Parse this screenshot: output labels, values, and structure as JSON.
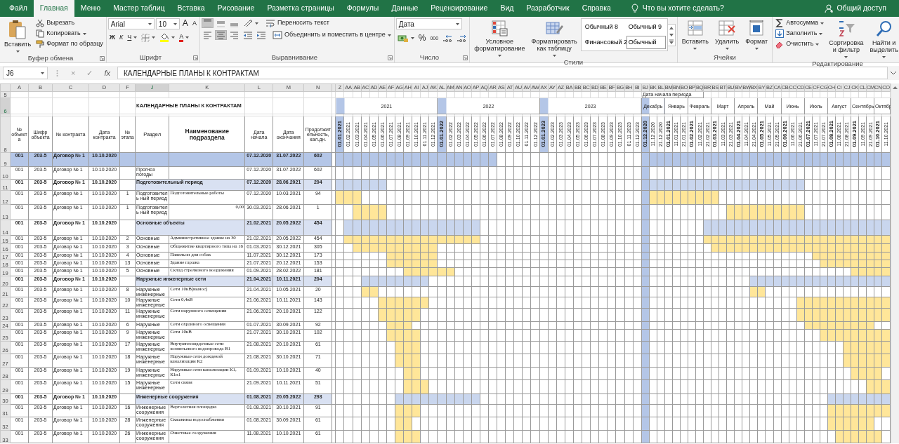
{
  "tabs": [
    {
      "label": "Файл",
      "selected": false
    },
    {
      "label": "Главная",
      "selected": true
    },
    {
      "label": "Меню",
      "selected": false
    },
    {
      "label": "Мастер таблиц",
      "selected": false
    },
    {
      "label": "Вставка",
      "selected": false
    },
    {
      "label": "Рисование",
      "selected": false
    },
    {
      "label": "Разметка страницы",
      "selected": false
    },
    {
      "label": "Формулы",
      "selected": false
    },
    {
      "label": "Данные",
      "selected": false
    },
    {
      "label": "Рецензирование",
      "selected": false
    },
    {
      "label": "Вид",
      "selected": false
    },
    {
      "label": "Разработчик",
      "selected": false
    },
    {
      "label": "Справка",
      "selected": false
    }
  ],
  "tell_me": "Что вы хотите сделать?",
  "share": "Общий доступ",
  "ribbon": [
    {
      "kind": "clipboard",
      "label": "Буфер обмена",
      "paste": "Вставить",
      "actions": [
        {
          "label": "Вырезать",
          "dropdown": false
        },
        {
          "label": "Копировать",
          "dropdown": true
        },
        {
          "label": "Формат по образцу",
          "dropdown": false
        }
      ]
    },
    {
      "kind": "font",
      "label": "Шрифт",
      "font": "Arial",
      "size": "10",
      "grow": "A",
      "shrink": "A",
      "bold": "Ж",
      "italic": "К",
      "underline": "Ч",
      "color_letter": "A"
    },
    {
      "kind": "alignment",
      "label": "Выравнивание",
      "vertical_align": [
        {
          "selected": true
        },
        {
          "selected": false
        },
        {
          "selected": false
        }
      ],
      "horizontal_align": [
        {
          "selected": false
        },
        {
          "selected": true
        },
        {
          "selected": false
        }
      ],
      "wrap": "Переносить текст",
      "merge": "Объединить и поместить в центре"
    },
    {
      "kind": "number",
      "label": "Число",
      "format": "Дата",
      "percent": "%",
      "thousands": "000"
    },
    {
      "kind": "styles",
      "label": "Стили",
      "buttons": [
        {
          "lines": [
            "Условное",
            "форматирование"
          ]
        },
        {
          "lines": [
            "Форматировать",
            "как таблицу"
          ]
        }
      ],
      "gallery": [
        {
          "label": "Обычный 8",
          "selected": false
        },
        {
          "label": "Обычный 9",
          "selected": false
        },
        {
          "label": "Финансовый 2",
          "selected": false
        },
        {
          "label": "Обычный",
          "selected": true
        }
      ]
    },
    {
      "kind": "cells",
      "label": "Ячейки",
      "buttons": [
        "Вставить",
        "Удалить",
        "Формат"
      ]
    },
    {
      "kind": "editing",
      "label": "Редактирование",
      "actions": [
        "Автосумма",
        "Заполнить",
        "Очистить"
      ],
      "buttons": [
        {
          "lines": [
            "Сортировка",
            "и фильтр"
          ]
        },
        {
          "lines": [
            "Найти и",
            "выделить"
          ]
        }
      ]
    }
  ],
  "formula_bar": {
    "name_box": "J6",
    "cancel": "×",
    "enter": "✓",
    "fx": "fx",
    "formula": "КАЛЕНДАРНЫЕ ПЛАНЫ К КОНТРАКТАМ"
  },
  "sheet": {
    "columns": [
      {
        "letter": "A",
        "heading": "№ объекта",
        "selected": false
      },
      {
        "letter": "B",
        "heading": "Шифр объекта",
        "selected": false
      },
      {
        "letter": "C",
        "heading": "№ контракта",
        "selected": false
      },
      {
        "letter": "D",
        "heading": "Дата контракта",
        "selected": false
      },
      {
        "letter": "F",
        "heading": "№ этапа",
        "selected": false
      },
      {
        "letter": "J",
        "heading": "Раздел",
        "selected": true
      },
      {
        "letter": "K",
        "heading": "Наименование подраздела",
        "selected": false
      },
      {
        "letter": "L",
        "heading": "Дата начала",
        "selected": false
      },
      {
        "letter": "M",
        "heading": "Дата окончания",
        "selected": false
      },
      {
        "letter": "N",
        "heading": "Продолжительность, кал.дн.",
        "selected": false
      }
    ],
    "header_rows": [
      {
        "number": "5",
        "selected": false
      },
      {
        "number": "6",
        "selected": true
      },
      {
        "number": "8",
        "selected": false
      }
    ],
    "title": "КАЛЕНДАРНЫЕ ПЛАНЫ К КОНТРАКТАМ",
    "period_caption": "Дата начала периода",
    "years": [
      {
        "label": "2021",
        "columns": [
          {
            "letter": "Z",
            "date": "01.01.2021",
            "bold": true,
            "highlighted": true,
            "current": false
          },
          {
            "letter": "AA",
            "date": "01.02.2021",
            "bold": false,
            "highlighted": false,
            "current": false
          },
          {
            "letter": "AB",
            "date": "01.03.2021",
            "bold": false,
            "highlighted": false,
            "current": false
          },
          {
            "letter": "AC",
            "date": "01.04.2021",
            "bold": false,
            "highlighted": false,
            "current": false
          },
          {
            "letter": "AD",
            "date": "01.05.2021",
            "bold": false,
            "highlighted": false,
            "current": false
          },
          {
            "letter": "AE",
            "date": "01.06.2021",
            "bold": false,
            "highlighted": false,
            "current": false
          },
          {
            "letter": "AF",
            "date": "01.07.2021",
            "bold": false,
            "highlighted": false,
            "current": false
          },
          {
            "letter": "AG",
            "date": "01.08.2021",
            "bold": false,
            "highlighted": false,
            "current": false
          },
          {
            "letter": "AH",
            "date": "01.09.2021",
            "bold": false,
            "highlighted": false,
            "current": false
          },
          {
            "letter": "AI",
            "date": "01.10.2021",
            "bold": false,
            "highlighted": false,
            "current": false
          },
          {
            "letter": "AJ",
            "date": "01.11.2021",
            "bold": false,
            "highlighted": false,
            "current": false
          },
          {
            "letter": "AK",
            "date": "01.12.2021",
            "bold": false,
            "highlighted": false,
            "current": false
          }
        ]
      },
      {
        "label": "2022",
        "columns": [
          {
            "letter": "AL",
            "date": "01.01.2022",
            "bold": true,
            "highlighted": true,
            "current": false
          },
          {
            "letter": "AM",
            "date": "01.02.2022",
            "bold": false,
            "highlighted": false,
            "current": false
          },
          {
            "letter": "AN",
            "date": "01.03.2022",
            "bold": false,
            "highlighted": false,
            "current": false
          },
          {
            "letter": "AO",
            "date": "01.04.2022",
            "bold": false,
            "highlighted": false,
            "current": false
          },
          {
            "letter": "AP",
            "date": "01.05.2022",
            "bold": false,
            "highlighted": false,
            "current": false
          },
          {
            "letter": "AQ",
            "date": "01.06.2022",
            "bold": false,
            "highlighted": false,
            "current": false
          },
          {
            "letter": "AR",
            "date": "01.07.2022",
            "bold": false,
            "highlighted": false,
            "current": false
          },
          {
            "letter": "AS",
            "date": "01.08.2022",
            "bold": false,
            "highlighted": false,
            "current": false
          },
          {
            "letter": "AT",
            "date": "01.09.2022",
            "bold": false,
            "highlighted": false,
            "current": false
          },
          {
            "letter": "AU",
            "date": "01.10.2022",
            "bold": false,
            "highlighted": false,
            "current": false
          },
          {
            "letter": "AV",
            "date": "01.11.2022",
            "bold": false,
            "highlighted": false,
            "current": false
          },
          {
            "letter": "AW",
            "date": "01.12.2022",
            "bold": false,
            "highlighted": false,
            "current": false
          }
        ]
      },
      {
        "label": "2023",
        "columns": [
          {
            "letter": "AX",
            "date": "01.01.2023",
            "bold": true,
            "highlighted": true,
            "current": false
          },
          {
            "letter": "AY",
            "date": "01.02.2023",
            "bold": false,
            "highlighted": false,
            "current": false
          },
          {
            "letter": "AZ",
            "date": "01.03.2023",
            "bold": false,
            "highlighted": false,
            "current": false
          },
          {
            "letter": "BA",
            "date": "01.04.2023",
            "bold": false,
            "highlighted": false,
            "current": false
          },
          {
            "letter": "BB",
            "date": "01.05.2023",
            "bold": false,
            "highlighted": false,
            "current": false
          },
          {
            "letter": "BC",
            "date": "01.06.2023",
            "bold": false,
            "highlighted": false,
            "current": false
          },
          {
            "letter": "BD",
            "date": "01.07.2023",
            "bold": false,
            "highlighted": false,
            "current": false
          },
          {
            "letter": "BE",
            "date": "01.08.2023",
            "bold": false,
            "highlighted": false,
            "current": false
          },
          {
            "letter": "BF",
            "date": "01.09.2023",
            "bold": false,
            "highlighted": false,
            "current": false
          },
          {
            "letter": "BG",
            "date": "01.10.2023",
            "bold": false,
            "highlighted": false,
            "current": false
          },
          {
            "letter": "BH",
            "date": "01.11.2023",
            "bold": false,
            "highlighted": false,
            "current": false
          },
          {
            "letter": "BI",
            "date": "01.12.2023",
            "bold": false,
            "highlighted": false,
            "current": false
          }
        ]
      }
    ],
    "months": [
      {
        "label": "Декабрь",
        "columns": [
          {
            "letter": "BJ",
            "date": "01.12.2020",
            "bold": true,
            "highlighted": true,
            "current": true
          },
          {
            "letter": "BK",
            "date": "11.12.2020",
            "bold": false,
            "highlighted": false,
            "current": false
          },
          {
            "letter": "BL",
            "date": "21.12.2020",
            "bold": false,
            "highlighted": false,
            "current": false
          }
        ]
      },
      {
        "label": "Январь",
        "columns": [
          {
            "letter": "BM",
            "date": "01.01.2021",
            "bold": true,
            "highlighted": false,
            "current": false
          },
          {
            "letter": "BN",
            "date": "11.01.2021",
            "bold": false,
            "highlighted": false,
            "current": false
          },
          {
            "letter": "BO",
            "date": "21.01.2021",
            "bold": false,
            "highlighted": false,
            "current": false
          }
        ]
      },
      {
        "label": "Февраль",
        "columns": [
          {
            "letter": "BP",
            "date": "01.02.2021",
            "bold": true,
            "highlighted": false,
            "current": false
          },
          {
            "letter": "BQ",
            "date": "11.02.2021",
            "bold": false,
            "highlighted": false,
            "current": false
          },
          {
            "letter": "BR",
            "date": "21.02.2021",
            "bold": false,
            "highlighted": false,
            "current": false
          }
        ]
      },
      {
        "label": "Март",
        "columns": [
          {
            "letter": "BS",
            "date": "01.03.2021",
            "bold": true,
            "highlighted": false,
            "current": false
          },
          {
            "letter": "BT",
            "date": "11.03.2021",
            "bold": false,
            "highlighted": false,
            "current": false
          },
          {
            "letter": "BU",
            "date": "21.03.2021",
            "bold": false,
            "highlighted": false,
            "current": false
          }
        ]
      },
      {
        "label": "Апрель",
        "columns": [
          {
            "letter": "BV",
            "date": "01.04.2021",
            "bold": true,
            "highlighted": false,
            "current": false
          },
          {
            "letter": "BW",
            "date": "11.04.2021",
            "bold": false,
            "highlighted": false,
            "current": false
          },
          {
            "letter": "BX",
            "date": "21.04.2021",
            "bold": false,
            "highlighted": false,
            "current": false
          }
        ]
      },
      {
        "label": "Май",
        "columns": [
          {
            "letter": "BY",
            "date": "01.05.2021",
            "bold": true,
            "highlighted": false,
            "current": false
          },
          {
            "letter": "BZ",
            "date": "11.05.2021",
            "bold": false,
            "highlighted": false,
            "current": false
          },
          {
            "letter": "CA",
            "date": "21.05.2021",
            "bold": false,
            "highlighted": false,
            "current": false
          }
        ]
      },
      {
        "label": "Июнь",
        "columns": [
          {
            "letter": "CB",
            "date": "01.06.2021",
            "bold": true,
            "highlighted": false,
            "current": false
          },
          {
            "letter": "CC",
            "date": "11.06.2021",
            "bold": false,
            "highlighted": false,
            "current": false
          },
          {
            "letter": "CD",
            "date": "21.06.2021",
            "bold": false,
            "highlighted": false,
            "current": false
          }
        ]
      },
      {
        "label": "Июль",
        "columns": [
          {
            "letter": "CE",
            "date": "01.07.2021",
            "bold": true,
            "highlighted": false,
            "current": false
          },
          {
            "letter": "CF",
            "date": "11.07.2021",
            "bold": false,
            "highlighted": false,
            "current": false
          },
          {
            "letter": "CG",
            "date": "21.07.2021",
            "bold": false,
            "highlighted": false,
            "current": false
          }
        ]
      },
      {
        "label": "Август",
        "columns": [
          {
            "letter": "CH",
            "date": "01.08.2021",
            "bold": true,
            "highlighted": false,
            "current": false
          },
          {
            "letter": "CI",
            "date": "11.08.2021",
            "bold": false,
            "highlighted": false,
            "current": false
          },
          {
            "letter": "CJ",
            "date": "21.08.2021",
            "bold": false,
            "highlighted": false,
            "current": false
          }
        ]
      },
      {
        "label": "Сентябрь",
        "columns": [
          {
            "letter": "CK",
            "date": "01.09.2021",
            "bold": true,
            "highlighted": false,
            "current": false
          },
          {
            "letter": "CL",
            "date": "11.09.2021",
            "bold": false,
            "highlighted": false,
            "current": false
          },
          {
            "letter": "CM",
            "date": "21.09.2021",
            "bold": false,
            "highlighted": false,
            "current": false
          }
        ]
      },
      {
        "label": "Октябр",
        "columns": [
          {
            "letter": "CN",
            "date": "01.10.2021",
            "bold": true,
            "highlighted": false,
            "current": false
          },
          {
            "letter": "CO",
            "date": "11.10.2021",
            "bold": false,
            "highlighted": false,
            "current": false
          }
        ]
      }
    ],
    "rows": [
      {
        "number": "9",
        "kind": "total",
        "selected": false,
        "object": "001",
        "code": "203-5",
        "contract": "Договор № 1",
        "contract_date": "10.10.2020",
        "start": "07.12.2020",
        "end": "31.07.2022",
        "duration": "602",
        "color": "#b4c6e7"
      },
      {
        "number": "10",
        "kind": "task",
        "selected": false,
        "object": "001",
        "code": "203-5",
        "contract": "Договор № 1",
        "contract_date": "10.10.2020",
        "section": "Прогноз погоды",
        "start": "07.12.2020",
        "end": "31.07.2022",
        "duration": "602"
      },
      {
        "number": "11",
        "kind": "section",
        "selected": false,
        "object": "001",
        "code": "203-5",
        "contract": "Договор № 1",
        "contract_date": "10.10.2020",
        "section": "Подготовительный период",
        "start": "07.12.2020",
        "end": "28.06.2021",
        "duration": "204",
        "color": "#c9d6ee"
      },
      {
        "number": "12",
        "kind": "task",
        "selected": false,
        "object": "001",
        "code": "203-5",
        "contract": "Договор № 1",
        "contract_date": "10.10.2020",
        "stage": "1",
        "section": "Подготовитель ный период",
        "subsection": "Подготовительные работы",
        "start": "07.12.2020",
        "end": "10.03.2021",
        "duration": "94",
        "color": "#ffe699"
      },
      {
        "number": "13",
        "kind": "amount",
        "selected": false,
        "object": "001",
        "code": "203-5",
        "contract": "Договор № 1",
        "contract_date": "10.10.2020",
        "stage": "1",
        "section": "Подготовитель ный период",
        "subsection": "0,00",
        "start": "30.03.2021",
        "end": "28.06.2021",
        "duration": "1",
        "color": "#ffe699"
      },
      {
        "number": "14",
        "kind": "section",
        "selected": false,
        "object": "001",
        "code": "203-5",
        "contract": "Договор № 1",
        "contract_date": "10.10.2020",
        "section": "Основные объекты",
        "start": "21.02.2021",
        "end": "20.05.2022",
        "duration": "454",
        "color": "#c9d6ee"
      },
      {
        "number": "15",
        "kind": "task",
        "selected": false,
        "object": "001",
        "code": "203-5",
        "contract": "Договор № 1",
        "contract_date": "10.10.2020",
        "stage": "2",
        "section": "Основные",
        "subsection": "Административное здание на 30",
        "start": "21.02.2021",
        "end": "20.05.2022",
        "duration": "454",
        "color": "#ffe699"
      },
      {
        "number": "16",
        "kind": "task",
        "selected": false,
        "object": "001",
        "code": "203-5",
        "contract": "Договор № 1",
        "contract_date": "10.10.2020",
        "stage": "3",
        "section": "Основные",
        "subsection": "Общежитие квартирного типа на 16",
        "start": "01.03.2021",
        "end": "30.12.2021",
        "duration": "305",
        "color": "#ffe699"
      },
      {
        "number": "17",
        "kind": "task",
        "selected": false,
        "object": "001",
        "code": "203-5",
        "contract": "Договор № 1",
        "contract_date": "10.10.2020",
        "stage": "4",
        "section": "Основные",
        "subsection": "Павильон для собак",
        "start": "11.07.2021",
        "end": "30.12.2021",
        "duration": "173",
        "color": "#ffe699"
      },
      {
        "number": "18",
        "kind": "task",
        "selected": false,
        "object": "001",
        "code": "203-5",
        "contract": "Договор № 1",
        "contract_date": "10.10.2020",
        "stage": "13",
        "section": "Основные",
        "subsection": "Здание гаража",
        "start": "21.07.2021",
        "end": "20.12.2021",
        "duration": "153",
        "color": "#ffe699"
      },
      {
        "number": "19",
        "kind": "task",
        "selected": false,
        "object": "001",
        "code": "203-5",
        "contract": "Договор № 1",
        "contract_date": "10.10.2020",
        "stage": "5",
        "section": "Основные",
        "subsection": "Склад стрелкового вооружения",
        "start": "01.09.2021",
        "end": "28.02.2022",
        "duration": "181",
        "color": "#ffe699"
      },
      {
        "number": "20",
        "kind": "section",
        "selected": false,
        "object": "001",
        "code": "203-5",
        "contract": "Договор № 1",
        "contract_date": "10.10.2020",
        "section": "Наружные инженерные сети",
        "start": "21.04.2021",
        "end": "10.11.2021",
        "duration": "204",
        "color": "#c9d6ee"
      },
      {
        "number": "21",
        "kind": "task",
        "selected": false,
        "object": "001",
        "code": "203-5",
        "contract": "Договор № 1",
        "contract_date": "10.10.2020",
        "stage": "8",
        "section": "Наружные инженерные",
        "subsection": "Сети 10кВ(вынос)",
        "start": "21.04.2021",
        "end": "10.05.2021",
        "duration": "20",
        "color": "#ffe699"
      },
      {
        "number": "22",
        "kind": "task",
        "selected": false,
        "object": "001",
        "code": "203-5",
        "contract": "Договор № 1",
        "contract_date": "10.10.2020",
        "stage": "10",
        "section": "Наружные инженерные",
        "subsection": "Сети 0,4кВ",
        "start": "21.06.2021",
        "end": "10.11.2021",
        "duration": "143",
        "color": "#ffe699"
      },
      {
        "number": "23",
        "kind": "task",
        "selected": false,
        "object": "001",
        "code": "203-5",
        "contract": "Договор № 1",
        "contract_date": "10.10.2020",
        "stage": "11",
        "section": "Наружные инженерные",
        "subsection": "Сети наружного освещения",
        "start": "21.06.2021",
        "end": "20.10.2021",
        "duration": "122",
        "color": "#ffe699"
      },
      {
        "number": "24",
        "kind": "task",
        "selected": false,
        "object": "001",
        "code": "203-5",
        "contract": "Договор № 1",
        "contract_date": "10.10.2020",
        "stage": "6",
        "section": "Наружные",
        "subsection": "Сети охранного освещения",
        "start": "01.07.2021",
        "end": "30.09.2021",
        "duration": "92",
        "color": "#ffe699"
      },
      {
        "number": "25",
        "kind": "task",
        "selected": false,
        "object": "001",
        "code": "203-5",
        "contract": "Договор № 1",
        "contract_date": "10.10.2020",
        "stage": "9",
        "section": "Наружные инженерные",
        "subsection": "Сети 10кВ",
        "start": "21.07.2021",
        "end": "30.10.2021",
        "duration": "102",
        "color": "#ffe699"
      },
      {
        "number": "26",
        "kind": "task",
        "selected": false,
        "object": "001",
        "code": "203-5",
        "contract": "Договор № 1",
        "contract_date": "10.10.2020",
        "stage": "17",
        "section": "Наружные инженерные",
        "subsection": "Внутриплощадочные сети хозпитьевого водопровода В1",
        "start": "21.08.2021",
        "end": "20.10.2021",
        "duration": "61",
        "color": "#ffe699"
      },
      {
        "number": "27",
        "kind": "task",
        "selected": false,
        "object": "001",
        "code": "203-5",
        "contract": "Договор № 1",
        "contract_date": "10.10.2020",
        "stage": "18",
        "section": "Наружные инженерные",
        "subsection": "Наружные сети дождевой канализации К2",
        "start": "21.08.2021",
        "end": "30.10.2021",
        "duration": "71",
        "color": "#ffe699"
      },
      {
        "number": "28",
        "kind": "task",
        "selected": false,
        "object": "001",
        "code": "203-5",
        "contract": "Договор № 1",
        "contract_date": "10.10.2020",
        "stage": "19",
        "section": "Наружные инженерные",
        "subsection": "Наружные сети канализации К1, К1н1",
        "start": "01.09.2021",
        "end": "10.10.2021",
        "duration": "40",
        "color": "#ffe699"
      },
      {
        "number": "29",
        "kind": "task",
        "selected": false,
        "object": "001",
        "code": "203-5",
        "contract": "Договор № 1",
        "contract_date": "10.10.2020",
        "stage": "15",
        "section": "Наружные инженерные",
        "subsection": "Сети связи",
        "start": "21.09.2021",
        "end": "10.11.2021",
        "duration": "51",
        "color": "#ffe699"
      },
      {
        "number": "30",
        "kind": "section",
        "selected": false,
        "object": "001",
        "code": "203-5",
        "contract": "Договор № 1",
        "contract_date": "10.10.2020",
        "section": "Инженерные сооружения",
        "start": "01.08.2021",
        "end": "20.05.2022",
        "duration": "293",
        "color": "#c9d6ee"
      },
      {
        "number": "31",
        "kind": "task",
        "selected": false,
        "object": "001",
        "code": "203-5",
        "contract": "Договор № 1",
        "contract_date": "10.10.2020",
        "stage": "16",
        "section": "Инженерные сооружения",
        "subsection": "Вертолетная площадка",
        "start": "01.08.2021",
        "end": "30.10.2021",
        "duration": "91",
        "color": "#ffe699"
      },
      {
        "number": "32",
        "kind": "task",
        "selected": false,
        "object": "001",
        "code": "203-5",
        "contract": "Договор № 1",
        "contract_date": "10.10.2020",
        "stage": "28",
        "section": "Инженерные сооружения",
        "subsection": "Скважины водоснабжения",
        "start": "01.08.2021",
        "end": "30.09.2021",
        "duration": "61",
        "color": "#ffe699"
      },
      {
        "number": "33",
        "kind": "task",
        "selected": false,
        "object": "001",
        "code": "203-5",
        "contract": "Договор № 1",
        "contract_date": "10.10.2020",
        "stage": "26",
        "section": "Инженерные сооружения",
        "subsection": "Очистные сооружения",
        "start": "11.08.2021",
        "end": "10.10.2021",
        "duration": "61",
        "color": "#ffe699"
      }
    ]
  }
}
